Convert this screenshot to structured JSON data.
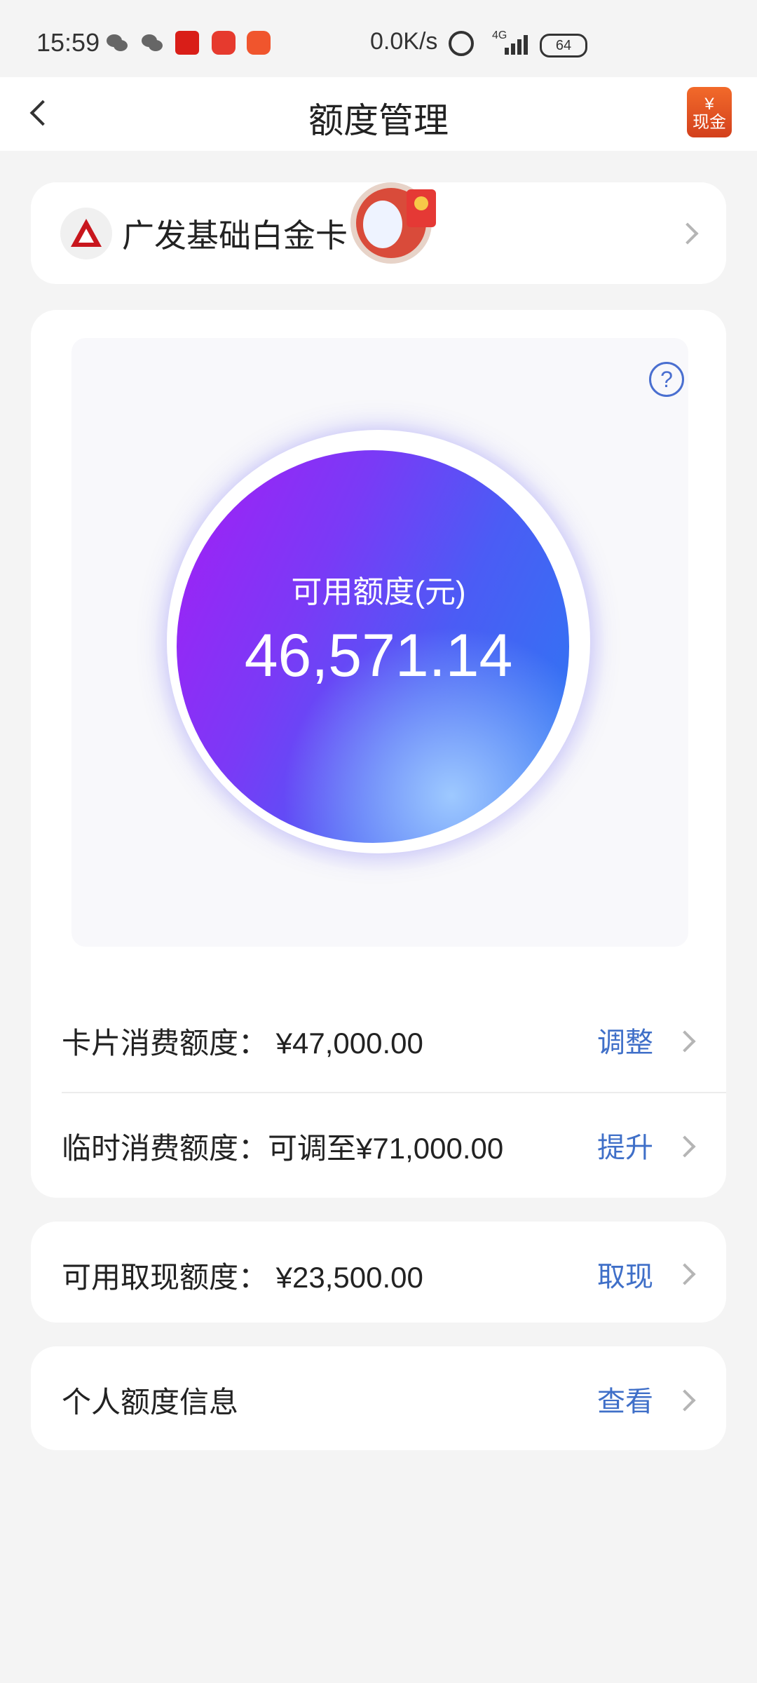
{
  "status_bar": {
    "time": "15:59",
    "network_speed": "0.0K/s",
    "signal_type": "4G",
    "battery": "64",
    "notification_icons": [
      "wechat-icon",
      "wechat-icon",
      "app-red-icon",
      "app-red-icon",
      "app-red-icon"
    ]
  },
  "header": {
    "title": "额度管理",
    "cash_icon_label": "现金",
    "cash_icon_badge": "¥"
  },
  "card_selector": {
    "name": "广发基础白金卡"
  },
  "available": {
    "label": "可用额度(元)",
    "amount": "46,571.14"
  },
  "rows": {
    "card_limit": {
      "label": "卡片消费额度：  ¥47,000.00",
      "action": "调整"
    },
    "temp_limit": {
      "label": "临时消费额度：可调至¥71,000.00",
      "action": "提升"
    },
    "cash_limit": {
      "label": "可用取现额度：  ¥23,500.00",
      "action": "取现"
    },
    "personal_info": {
      "label": "个人额度信息",
      "action": "查看"
    }
  },
  "colors": {
    "accent": "#3f6fc8",
    "background": "#f4f4f4",
    "orb_start": "#a51df5",
    "orb_end": "#2a7bf2"
  }
}
